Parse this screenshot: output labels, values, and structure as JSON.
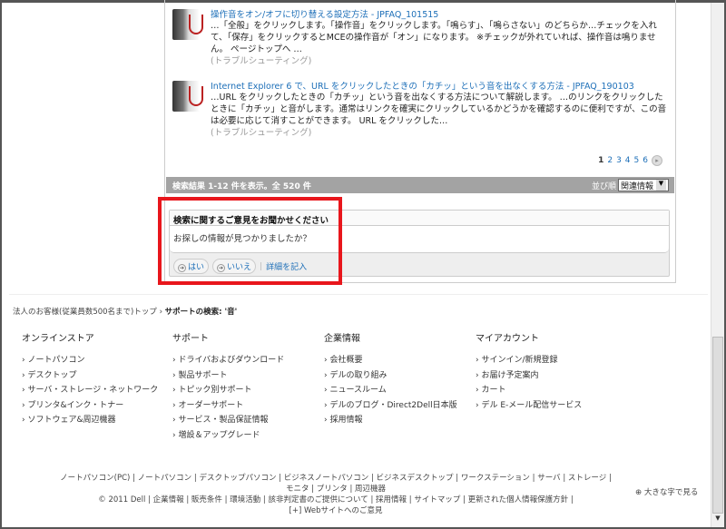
{
  "results": [
    {
      "title": "操作音をオン/オフに切り替える設定方法 - JPFAQ_101515",
      "desc": "…「全般」をクリックします。「操作音」をクリックします。「鳴らす」、「鳴らさない」のどちらか…チェックを入れて、「保存」をクリックするとMCEの操作音が「オン」になります。 ※チェックが外れていれば、操作音は鳴りません。 ページトップへ …",
      "category": "(トラブルシューティング)"
    },
    {
      "title": "Internet Explorer 6 で、URL をクリックしたときの「カチッ」という音を出なくする方法 - JPFAQ_190103",
      "desc": "…URL をクリックしたときの「カチッ」という音を出なくする方法について解説します。 …のリンクをクリックしたときに「カチッ」と音がします。通常はリンクを確実にクリックしているかどうかを確認するのに便利ですが、この音は必要に応じて消すことができます。 URL をクリックした…",
      "category": "(トラブルシューティング)"
    }
  ],
  "pager": {
    "pages": [
      "1",
      "2",
      "3",
      "4",
      "5",
      "6"
    ],
    "next": "▸"
  },
  "summary": "検索結果 1-12 件を表示。全 520 件",
  "sort": {
    "label": "並び順",
    "value": "関連情報",
    "arrow": "▼"
  },
  "feedback": {
    "title": "検索に関するご意見をお聞かせください",
    "question": "お探しの情報が見つかりましたか？",
    "yes": "はい",
    "no": "いいえ",
    "details": "詳細を記入"
  },
  "breadcrumb": {
    "home": "法人のお客様(従業員数500名まで)トップ",
    "sep": "›",
    "current": "サポートの検索: '音'"
  },
  "columns": [
    {
      "title": "オンラインストア",
      "items": [
        "ノートパソコン",
        "デスクトップ",
        "サーバ・ストレージ・ネットワーク",
        "プリンタ&インク・トナー",
        "ソフトウェア&周辺機器"
      ]
    },
    {
      "title": "サポート",
      "items": [
        "ドライバおよびダウンロード",
        "製品サポート",
        "トピック別サポート",
        "オーダーサポート",
        "サービス・製品保証情報",
        "増設＆アップグレード"
      ]
    },
    {
      "title": "企業情報",
      "items": [
        "会社概要",
        "デルの取り組み",
        "ニュースルーム",
        "デルのブログ・Direct2Dell日本版",
        "採用情報"
      ]
    },
    {
      "title": "マイアカウント",
      "items": [
        "サインイン/新規登録",
        "お届け予定案内",
        "カート",
        "デル E-メール配信サービス"
      ]
    }
  ],
  "footer": {
    "links1": [
      "ノートパソコン(PC)",
      "ノートパソコン",
      "デスクトップパソコン",
      "ビジネスノートパソコン",
      "ビジネスデスクトップ",
      "ワークステーション",
      "サーバ",
      "ストレージ",
      "モニタ",
      "プリンタ",
      "周辺機器"
    ],
    "copyright": "© 2011 Dell",
    "links2": [
      "企業情報",
      "販売条件",
      "環境活動",
      "該非判定書のご提供について",
      "採用情報",
      "サイトマップ",
      "更新された個人情報保護方針"
    ],
    "feedback": "[+] Webサイトへのご意見",
    "large_text": "⊕ 大きな字で見る"
  }
}
